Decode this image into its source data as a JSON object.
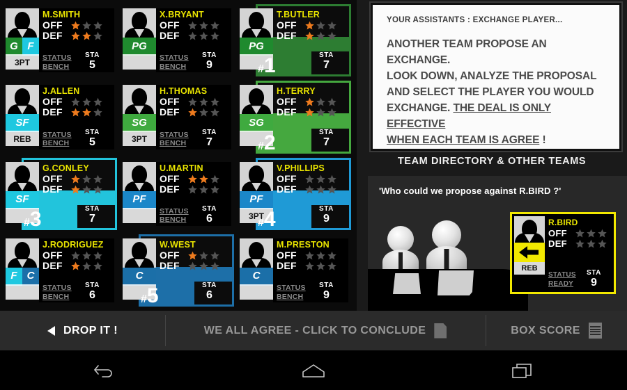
{
  "roster": {
    "players": [
      {
        "name": "M.SMITH",
        "positions": [
          {
            "label": "G",
            "color": "#1f8a2e"
          },
          {
            "label": "F",
            "color": "#1ec8e0"
          }
        ],
        "tag": "3PT",
        "off": 1,
        "def": 2,
        "status_label": "STATUS",
        "status_value": "BENCH",
        "sta_label": "STA",
        "sta_value": "5",
        "selected": false,
        "rank": "",
        "highlight": ""
      },
      {
        "name": "X.BRYANT",
        "positions": [
          {
            "label": "PG",
            "color": "#1f8a2e"
          }
        ],
        "tag": "",
        "off": 0,
        "def": 0,
        "status_label": "STATUS",
        "status_value": "BENCH",
        "sta_label": "STA",
        "sta_value": "9",
        "selected": false,
        "rank": "",
        "highlight": ""
      },
      {
        "name": "T.BUTLER",
        "positions": [
          {
            "label": "PG",
            "color": "#1f8a2e"
          }
        ],
        "tag": "",
        "off": 1,
        "def": 1,
        "status_label": "STATUS",
        "status_value": "",
        "sta_label": "STA",
        "sta_value": "7",
        "selected": true,
        "rank": "1",
        "highlight": "#2d7d32"
      },
      {
        "name": "J.ALLEN",
        "positions": [
          {
            "label": "SF",
            "color": "#1ec8e0"
          }
        ],
        "tag": "REB",
        "off": 0,
        "def": 2,
        "status_label": "STATUS",
        "status_value": "BENCH",
        "sta_label": "STA",
        "sta_value": "5",
        "selected": false,
        "rank": "",
        "highlight": ""
      },
      {
        "name": "H.THOMAS",
        "positions": [
          {
            "label": "SG",
            "color": "#3faa3f"
          }
        ],
        "tag": "3PT",
        "off": 0,
        "def": 1,
        "status_label": "STATUS",
        "status_value": "BENCH",
        "sta_label": "STA",
        "sta_value": "7",
        "selected": false,
        "rank": "",
        "highlight": ""
      },
      {
        "name": "H.TERRY",
        "positions": [
          {
            "label": "SG",
            "color": "#3faa3f"
          }
        ],
        "tag": "",
        "off": 1,
        "def": 1,
        "status_label": "STATUS",
        "status_value": "",
        "sta_label": "STA",
        "sta_value": "7",
        "selected": true,
        "rank": "2",
        "highlight": "#45a83f"
      },
      {
        "name": "G.CONLEY",
        "positions": [
          {
            "label": "SF",
            "color": "#1ec8e0"
          }
        ],
        "tag": "",
        "off": 1,
        "def": 1,
        "status_label": "STATUS",
        "status_value": "",
        "sta_label": "STA",
        "sta_value": "7",
        "selected": true,
        "rank": "3",
        "highlight": "#22c4dc"
      },
      {
        "name": "U.MARTIN",
        "positions": [
          {
            "label": "PF",
            "color": "#1b87c9"
          }
        ],
        "tag": "",
        "off": 2,
        "def": 0,
        "status_label": "STATUS",
        "status_value": "BENCH",
        "sta_label": "STA",
        "sta_value": "6",
        "selected": false,
        "rank": "",
        "highlight": ""
      },
      {
        "name": "V.PHILLIPS",
        "positions": [
          {
            "label": "PF",
            "color": "#1b87c9"
          }
        ],
        "tag": "3PT",
        "off": 0,
        "def": 0,
        "status_label": "STATUS",
        "status_value": "",
        "sta_label": "STA",
        "sta_value": "9",
        "selected": true,
        "rank": "4",
        "highlight": "#1f9ad6"
      },
      {
        "name": "J.RODRIGUEZ",
        "positions": [
          {
            "label": "F",
            "color": "#1ec8e0"
          },
          {
            "label": "C",
            "color": "#1b6fa8"
          }
        ],
        "tag": "",
        "off": 0,
        "def": 1,
        "status_label": "STATUS",
        "status_value": "BENCH",
        "sta_label": "STA",
        "sta_value": "6",
        "selected": false,
        "rank": "",
        "highlight": ""
      },
      {
        "name": "W.WEST",
        "positions": [
          {
            "label": "C",
            "color": "#1b6fa8"
          }
        ],
        "tag": "",
        "off": 1,
        "def": 0,
        "status_label": "STATUS",
        "status_value": "",
        "sta_label": "STA",
        "sta_value": "6",
        "selected": true,
        "rank": "5",
        "highlight": "#1d6fa8"
      },
      {
        "name": "M.PRESTON",
        "positions": [
          {
            "label": "C",
            "color": "#1b6fa8"
          }
        ],
        "tag": "",
        "off": 0,
        "def": 0,
        "status_label": "STATUS",
        "status_value": "BENCH",
        "sta_label": "STA",
        "sta_value": "9",
        "selected": false,
        "rank": "",
        "highlight": ""
      }
    ],
    "labels": {
      "off": "OFF",
      "def": "DEF"
    }
  },
  "message": {
    "header": "YOUR ASSISTANTS :  EXCHANGE PLAYER...",
    "line1": "ANOTHER TEAM PROPOSE AN EXCHANGE.",
    "line2": "LOOK DOWN, ANALYZE THE PROPOSAL",
    "line3": "AND SELECT THE PLAYER YOU WOULD",
    "line4a": "EXCHANGE. ",
    "line4b": "THE DEAL IS ONLY EFFECTIVE",
    "line5b": "WHEN EACH TEAM IS AGREE",
    "line5c": " !"
  },
  "directory": {
    "title": "TEAM DIRECTORY & OTHER TEAMS",
    "question": "'Who could we propose against R.BIRD ?'",
    "offer": {
      "name": "R.BIRD",
      "off_label": "OFF",
      "def_label": "DEF",
      "off": 0,
      "def": 0,
      "tag": "REB",
      "status_label": "STATUS",
      "status_value": "READY",
      "sta_label": "STA",
      "sta_value": "9",
      "border_color": "#f2e800"
    }
  },
  "actionbar": {
    "drop_label": "DROP IT !",
    "agree_label_underlined": "WE ALL AGREE",
    "agree_label_rest": " - CLICK TO CONCLUDE",
    "boxscore_label": "BOX SCORE"
  },
  "colors": {
    "star_on": "#ee7b1e",
    "star_off": "#555555",
    "name": "#e9e400",
    "accent_green": "#2d7d32",
    "accent_cyan": "#22c4dc",
    "accent_blue": "#1f9ad6",
    "accent_yellow": "#f2e800"
  }
}
